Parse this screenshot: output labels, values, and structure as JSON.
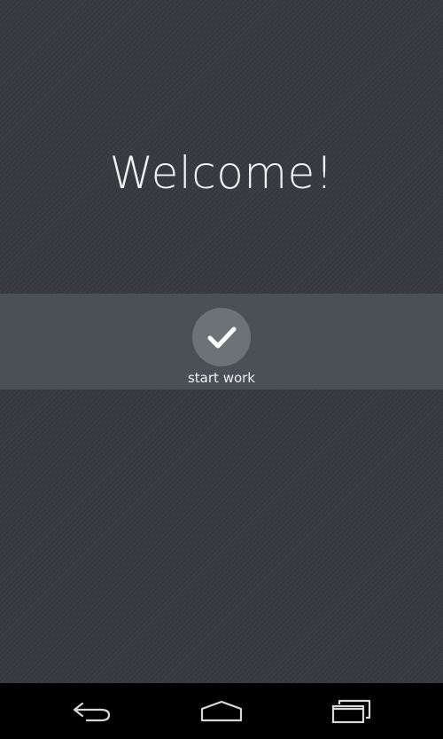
{
  "welcome": {
    "title": "Welcome!"
  },
  "action": {
    "label": "start work",
    "icon": "checkmark-icon"
  },
  "navigation_bar": {
    "back_icon": "back-icon",
    "home_icon": "home-icon",
    "recents_icon": "recent-apps-icon"
  },
  "colors": {
    "background": "#38393f",
    "band": "#4a5156",
    "button_circle": "#6c7276",
    "text": "#f2f2f2",
    "nav_bar": "#000000"
  }
}
